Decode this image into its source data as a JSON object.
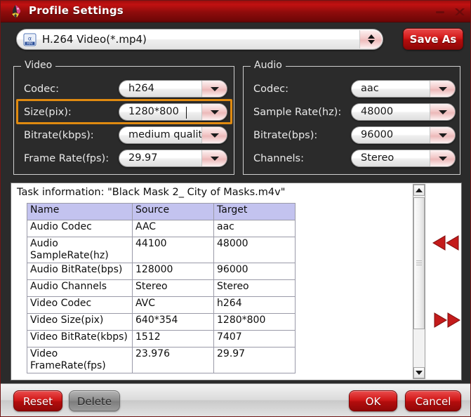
{
  "window": {
    "title": "Profile Settings",
    "icon": "app-bird-icon",
    "minimize_label": "–",
    "close_label": "✕",
    "accent_red": "#c21111",
    "highlight_orange": "#e08a10",
    "panel_dark": "#2b2b2b",
    "table_header_bg": "#c3c3ef"
  },
  "profile": {
    "icon": "mp4-file-icon",
    "value": "H.264 Video(*.mp4)",
    "spinner": "updown-spinner-icon",
    "save_as_label": "Save As"
  },
  "video": {
    "legend": "Video",
    "fields": [
      {
        "label": "Codec:",
        "value": "h264",
        "caret": false
      },
      {
        "label": "Size(pix):",
        "value": "1280*800",
        "caret": true
      },
      {
        "label": "Bitrate(kbps):",
        "value": "medium quality",
        "caret": false
      },
      {
        "label": "Frame Rate(fps):",
        "value": "29.97",
        "caret": false
      }
    ]
  },
  "audio": {
    "legend": "Audio",
    "fields": [
      {
        "label": "Codec:",
        "value": "aac"
      },
      {
        "label": "Sample Rate(hz):",
        "value": "48000"
      },
      {
        "label": "Bitrate(bps):",
        "value": "96000"
      },
      {
        "label": "Channels:",
        "value": "Stereo"
      }
    ]
  },
  "task": {
    "title": "Task information: \"Black Mask 2_ City of Masks.m4v\"",
    "columns": [
      "Name",
      "Source",
      "Target"
    ],
    "rows": [
      [
        "Audio Codec",
        "AAC",
        "aac"
      ],
      [
        "Audio SampleRate(hz)",
        "44100",
        "48000"
      ],
      [
        "Audio BitRate(bps)",
        "128000",
        "96000"
      ],
      [
        "Audio Channels",
        "Stereo",
        "Stereo"
      ],
      [
        "Video Codec",
        "AVC",
        "h264"
      ],
      [
        "Video Size(pix)",
        "640*354",
        "1280*800"
      ],
      [
        "Video BitRate(kbps)",
        "1512",
        "7407"
      ],
      [
        "Video FrameRate(fps)",
        "23.976",
        "29.97"
      ]
    ]
  },
  "scrollbar": {
    "up_icon": "scroll-up-arrow-icon",
    "down_icon": "scroll-down-arrow-icon",
    "thumb_icon": "scrollbar-thumb-grip"
  },
  "navigation": {
    "prev_icon": "double-left-arrow-icon",
    "next_icon": "double-right-arrow-icon"
  },
  "footer": {
    "reset_label": "Reset",
    "delete_label": "Delete",
    "ok_label": "OK",
    "cancel_label": "Cancel"
  }
}
